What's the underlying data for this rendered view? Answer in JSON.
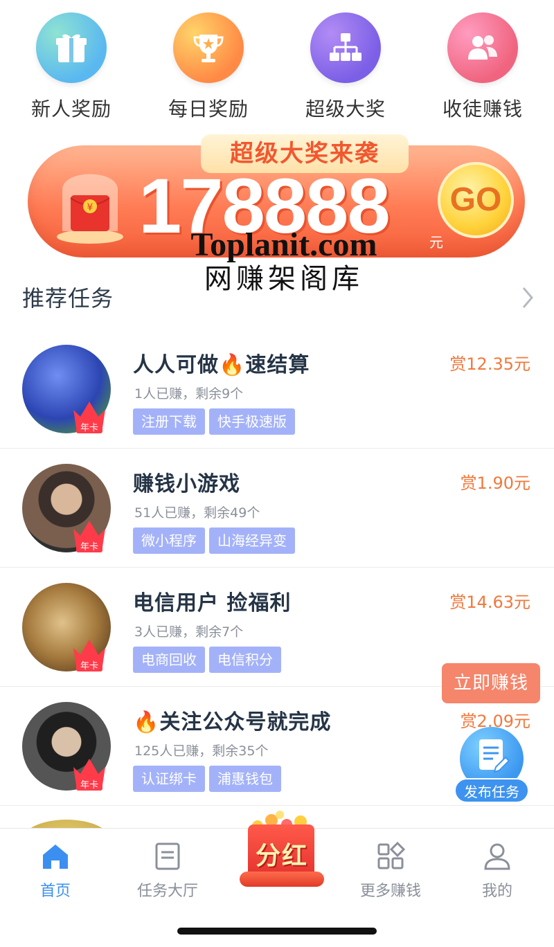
{
  "quick_entries": [
    {
      "label": "新人奖励",
      "icon": "gift-icon"
    },
    {
      "label": "每日奖励",
      "icon": "trophy-icon"
    },
    {
      "label": "超级大奖",
      "icon": "hierarchy-icon"
    },
    {
      "label": "收徒赚钱",
      "icon": "people-icon"
    }
  ],
  "banner": {
    "tab_title": "超级大奖来袭",
    "amount": "178888",
    "unit": "元",
    "go_label": "GO"
  },
  "watermark": {
    "top": "Toplanit.com",
    "bottom": "网赚架阁库"
  },
  "section": {
    "title": "推荐任务"
  },
  "avatar_badge": "年卡",
  "tasks": [
    {
      "title": "人人可做🔥速结算",
      "meta": "1人已赚，剩余9个",
      "tags": [
        "注册下载",
        "快手极速版"
      ],
      "reward": "赏12.35元",
      "avatar_color": "#3d5fc8"
    },
    {
      "title": "赚钱小游戏",
      "meta": "51人已赚，剩余49个",
      "tags": [
        "微小程序",
        "山海经异变"
      ],
      "reward": "赏1.90元",
      "avatar_color": "#6b5a4c"
    },
    {
      "title": "电信用户 捡福利",
      "meta": "3人已赚，剩余7个",
      "tags": [
        "电商回收",
        "电信积分"
      ],
      "reward": "赏14.63元",
      "avatar_color": "#9a7a45"
    },
    {
      "title": "🔥关注公众号就完成",
      "meta": "125人已赚，剩余35个",
      "tags": [
        "认证绑卡",
        "浦惠钱包"
      ],
      "reward": "赏2.09元",
      "avatar_color": "#4a4a4a"
    }
  ],
  "floating": {
    "earn_now": "立即赚钱",
    "publish": "发布任务"
  },
  "bottom_nav": [
    {
      "label": "首页",
      "icon": "home-icon",
      "active": true
    },
    {
      "label": "任务大厅",
      "icon": "task-hall-icon",
      "active": false
    },
    {
      "label": "分红",
      "icon": "red-packet-icon",
      "active": false
    },
    {
      "label": "更多赚钱",
      "icon": "grid-icon",
      "active": false
    },
    {
      "label": "我的",
      "icon": "user-icon",
      "active": false
    }
  ],
  "colors": {
    "accent": "#3b8ff0",
    "reward": "#f0793d",
    "tag": "#a3b2f8",
    "earn_now": "#f5856b"
  }
}
